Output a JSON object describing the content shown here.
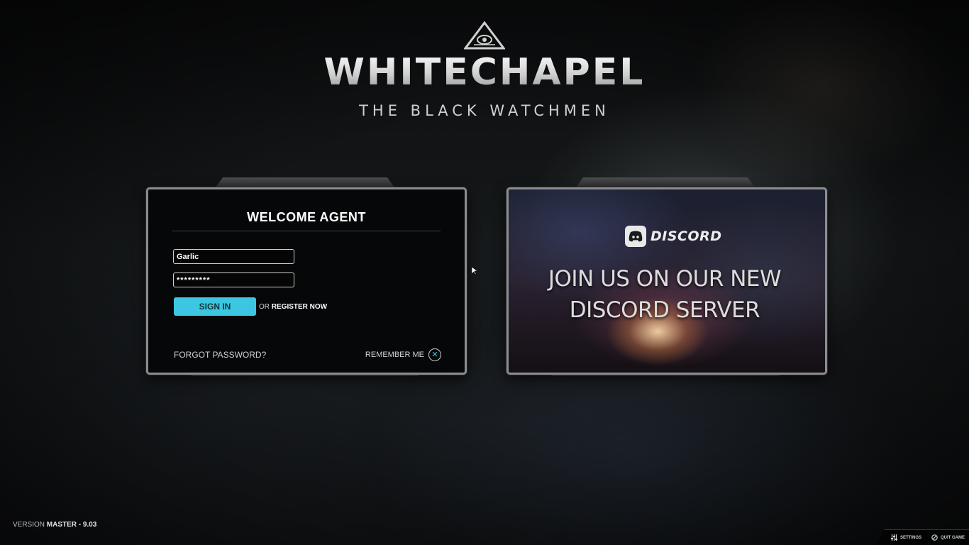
{
  "header": {
    "logo_icon": "all-seeing-eye-triangle-icon",
    "title": "WHITECHAPEL",
    "subtitle": "THE BLACK WATCHMEN"
  },
  "login": {
    "heading": "WELCOME AGENT",
    "username_value": "Garlic",
    "password_value": "*********",
    "signin_label": "SIGN IN",
    "or_text": "OR",
    "register_label": "REGISTER NOW",
    "forgot_label": "FORGOT PASSWORD?",
    "remember_label": "REMEMBER ME",
    "remember_icon": "close-x-icon",
    "accent_color": "#3cc6e1"
  },
  "discord": {
    "brand": "DISCORD",
    "brand_icon": "discord-icon",
    "headline_line1": "JOIN US ON OUR NEW",
    "headline_line2": "DISCORD SERVER"
  },
  "footer": {
    "version_prefix": "VERSION",
    "version_value": "MASTER - 9.03",
    "settings_label": "SETTINGS",
    "settings_icon": "sliders-icon",
    "quit_label": "QUIT GAME",
    "quit_icon": "quit-icon"
  }
}
